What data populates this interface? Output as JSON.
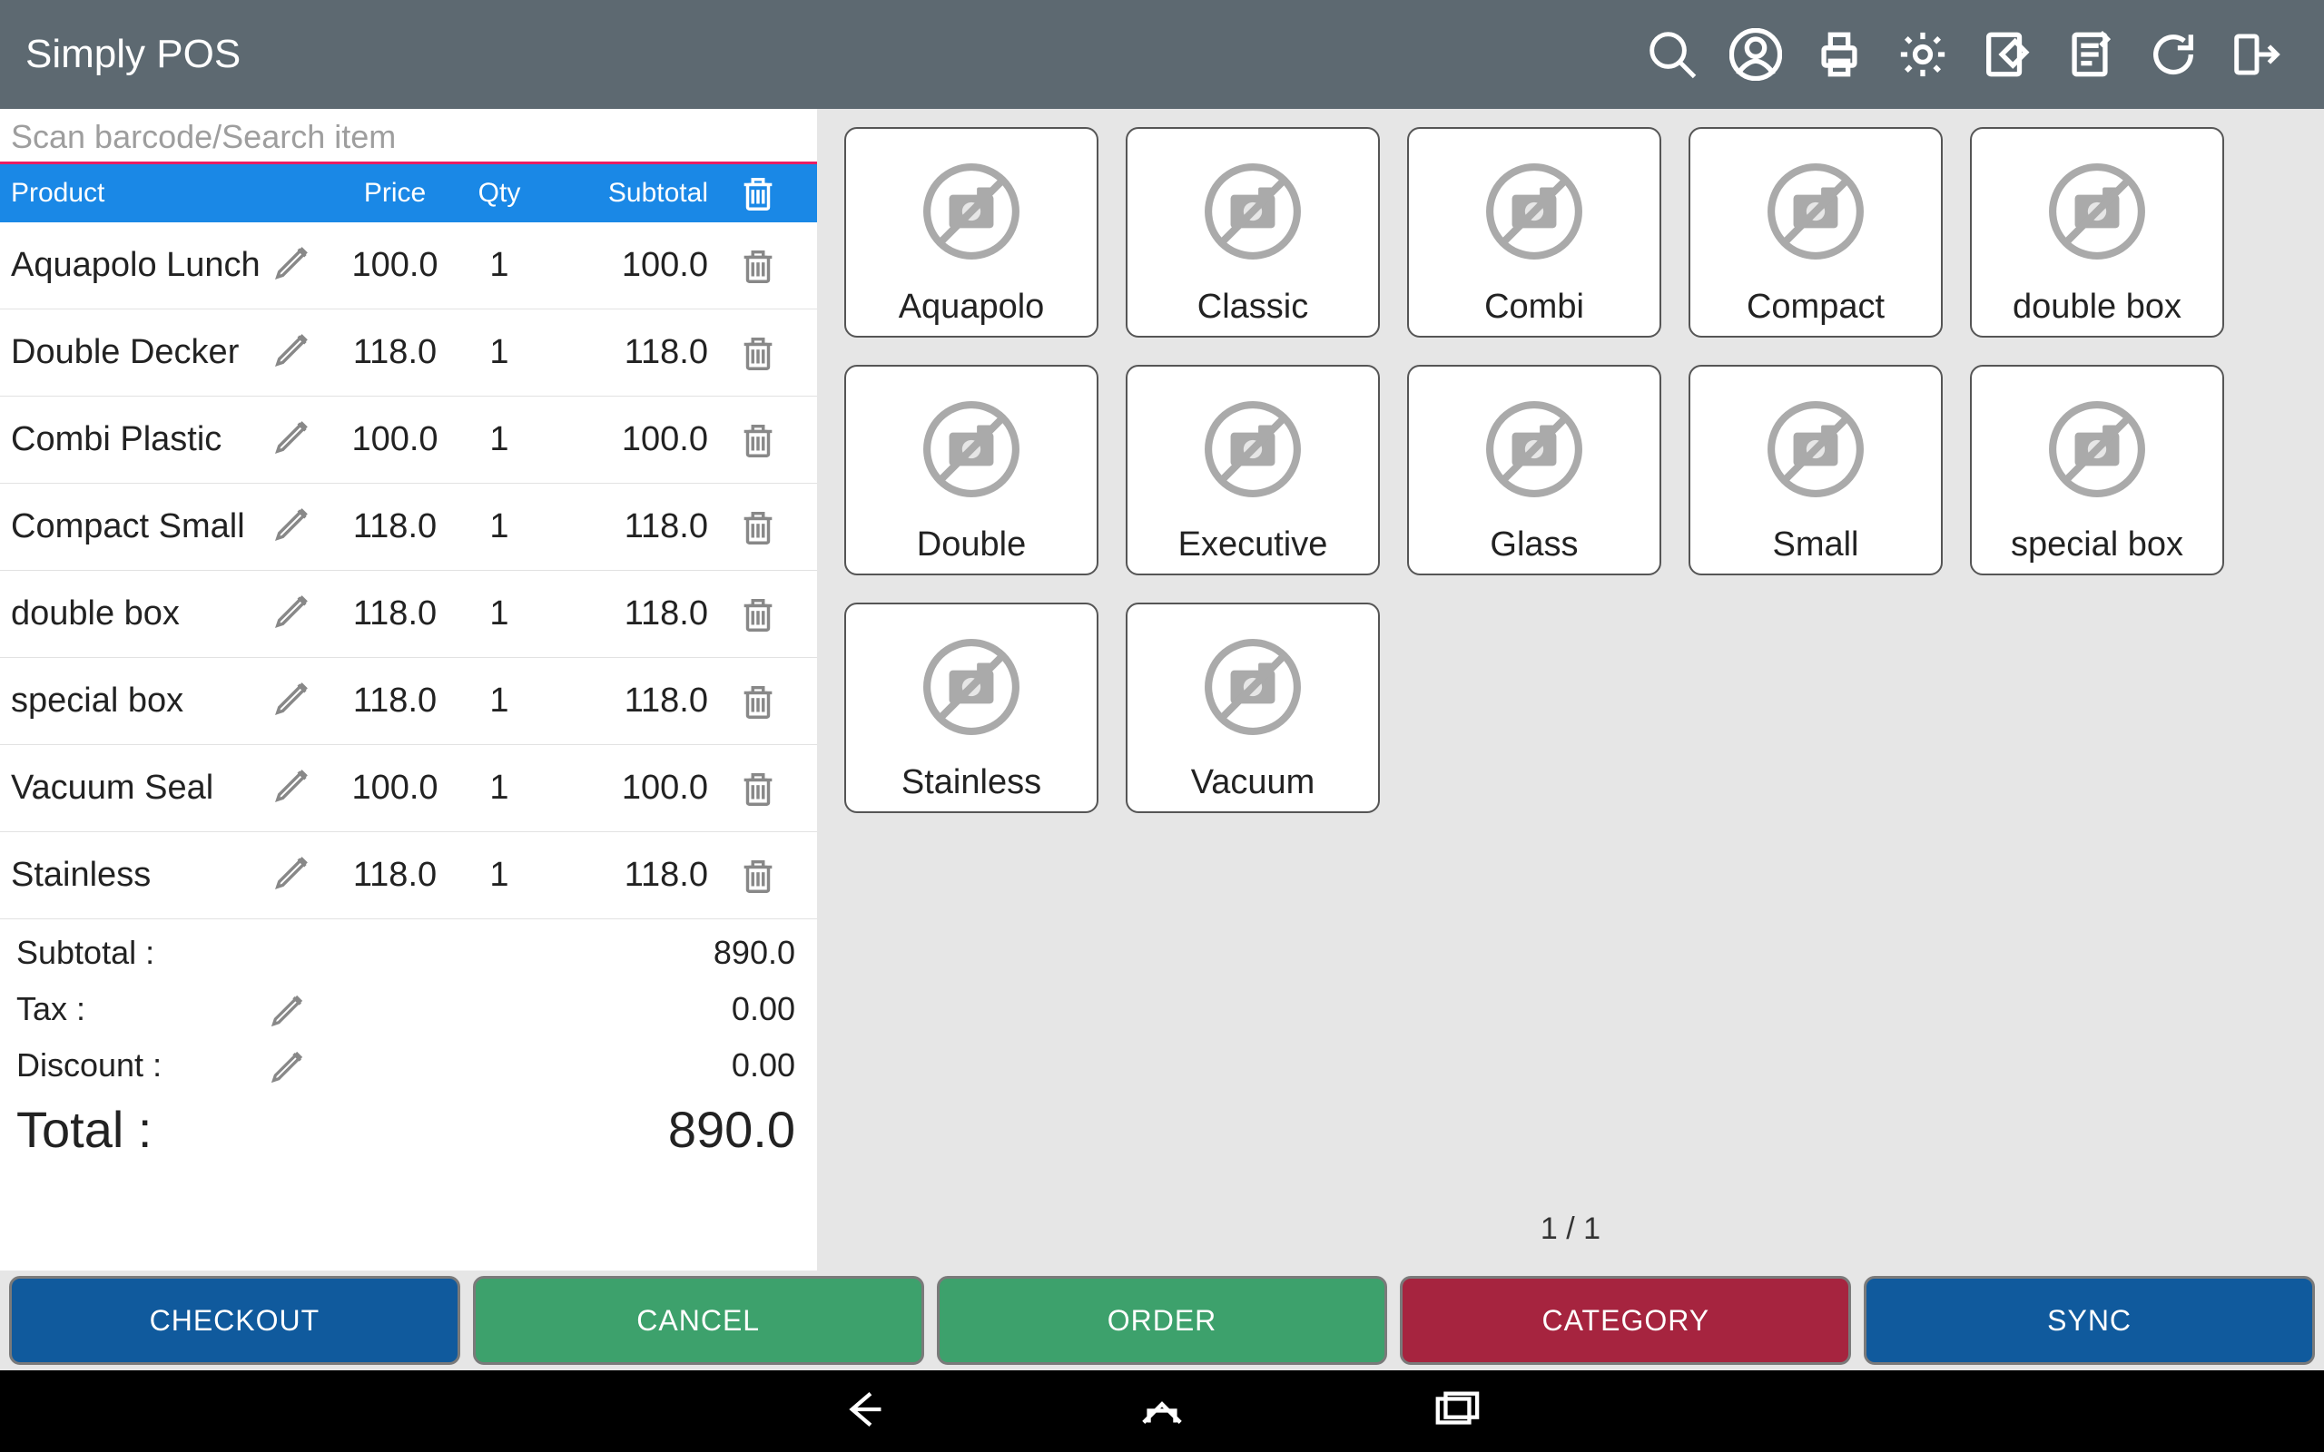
{
  "app": {
    "title": "Simply POS"
  },
  "search": {
    "placeholder": "Scan barcode/Search item",
    "value": ""
  },
  "columns": {
    "product": "Product",
    "price": "Price",
    "qty": "Qty",
    "subtotal": "Subtotal"
  },
  "cart": [
    {
      "name": "Aquapolo Lunch",
      "price": "100.0",
      "qty": "1",
      "subtotal": "100.0"
    },
    {
      "name": "Double Decker",
      "price": "118.0",
      "qty": "1",
      "subtotal": "118.0"
    },
    {
      "name": "Combi Plastic",
      "price": "100.0",
      "qty": "1",
      "subtotal": "100.0"
    },
    {
      "name": "Compact Small",
      "price": "118.0",
      "qty": "1",
      "subtotal": "118.0"
    },
    {
      "name": "double box",
      "price": "118.0",
      "qty": "1",
      "subtotal": "118.0"
    },
    {
      "name": "special box",
      "price": "118.0",
      "qty": "1",
      "subtotal": "118.0"
    },
    {
      "name": "Vacuum Seal",
      "price": "100.0",
      "qty": "1",
      "subtotal": "100.0"
    },
    {
      "name": "Stainless",
      "price": "118.0",
      "qty": "1",
      "subtotal": "118.0"
    }
  ],
  "totals": {
    "subtotal_label": "Subtotal :",
    "subtotal": "890.0",
    "tax_label": "Tax :",
    "tax": "0.00",
    "discount_label": "Discount :",
    "discount": "0.00",
    "total_label": "Total :",
    "total": "890.0"
  },
  "products": [
    "Aquapolo",
    "Classic",
    "Combi",
    "Compact",
    "double box",
    "Double",
    "Executive",
    "Glass",
    "Small",
    "special box",
    "Stainless",
    "Vacuum"
  ],
  "pager": "1 / 1",
  "buttons": {
    "checkout": "CHECKOUT",
    "cancel": "CANCEL",
    "order": "ORDER",
    "category": "CATEGORY",
    "sync": "SYNC"
  }
}
